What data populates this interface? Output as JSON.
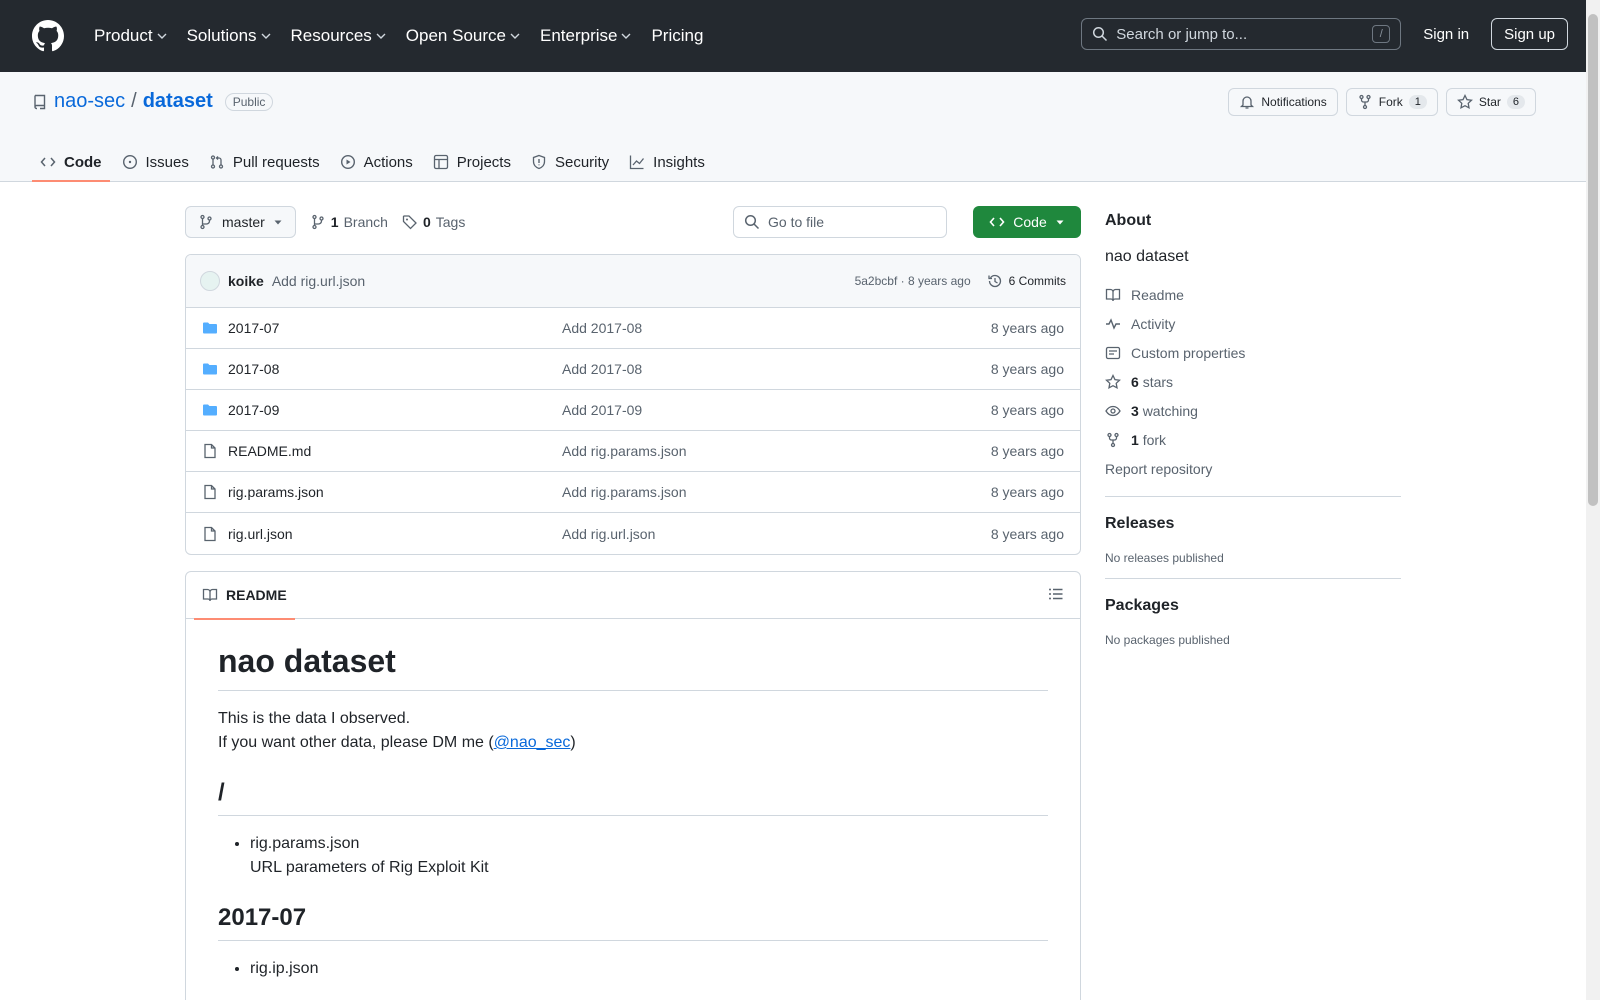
{
  "header": {
    "nav": [
      "Product",
      "Solutions",
      "Resources",
      "Open Source",
      "Enterprise"
    ],
    "pricing": "Pricing",
    "search_placeholder": "Search or jump to...",
    "search_key": "/",
    "sign_in": "Sign in",
    "sign_up": "Sign up"
  },
  "repo": {
    "owner": "nao-sec",
    "separator": "/",
    "name": "dataset",
    "visibility": "Public",
    "notifications": "Notifications",
    "fork_label": "Fork",
    "fork_count": "1",
    "star_label": "Star",
    "star_count": "6",
    "tabs": [
      "Code",
      "Issues",
      "Pull requests",
      "Actions",
      "Projects",
      "Security",
      "Insights"
    ]
  },
  "toolbar": {
    "branch": "master",
    "branch_count": "1",
    "branch_label": "Branch",
    "tag_count": "0",
    "tag_label": "Tags",
    "goto_placeholder": "Go to file",
    "code_button": "Code"
  },
  "commit": {
    "author": "koike",
    "message": "Add rig.url.json",
    "hash_time": "5a2bcbf · 8 years ago",
    "commits": "6 Commits"
  },
  "files": [
    {
      "name": "2017-07",
      "type": "dir",
      "message": "Add 2017-08",
      "time": "8 years ago"
    },
    {
      "name": "2017-08",
      "type": "dir",
      "message": "Add 2017-08",
      "time": "8 years ago"
    },
    {
      "name": "2017-09",
      "type": "dir",
      "message": "Add 2017-09",
      "time": "8 years ago"
    },
    {
      "name": "README.md",
      "type": "file",
      "message": "Add rig.params.json",
      "time": "8 years ago"
    },
    {
      "name": "rig.params.json",
      "type": "file",
      "message": "Add rig.params.json",
      "time": "8 years ago"
    },
    {
      "name": "rig.url.json",
      "type": "file",
      "message": "Add rig.url.json",
      "time": "8 years ago"
    }
  ],
  "readme": {
    "tab": "README",
    "title": "nao dataset",
    "line1": "This is the data I observed.",
    "line2_pre": "If you want other data, please DM me (",
    "mention": "@nao_sec",
    "line2_post": ")",
    "h_root": "/",
    "root_item_name": "rig.params.json",
    "root_item_desc": "URL parameters of Rig Exploit Kit",
    "h_2017_07": "2017-07",
    "item_2017_07": "rig.ip.json"
  },
  "sidebar": {
    "about_title": "About",
    "about_desc": "nao dataset",
    "readme": "Readme",
    "activity": "Activity",
    "custom_props": "Custom properties",
    "stars_count": "6",
    "stars_label": "stars",
    "watching_count": "3",
    "watching_label": "watching",
    "fork_count": "1",
    "fork_label": "fork",
    "report": "Report repository",
    "releases_title": "Releases",
    "releases_text": "No releases published",
    "packages_title": "Packages",
    "packages_text": "No packages published"
  },
  "colors": {
    "header_bg": "#24292f",
    "accent_link": "#0969da",
    "code_button": "#1f883d",
    "tab_underline": "#fd8c73",
    "folder": "#54aeff"
  }
}
